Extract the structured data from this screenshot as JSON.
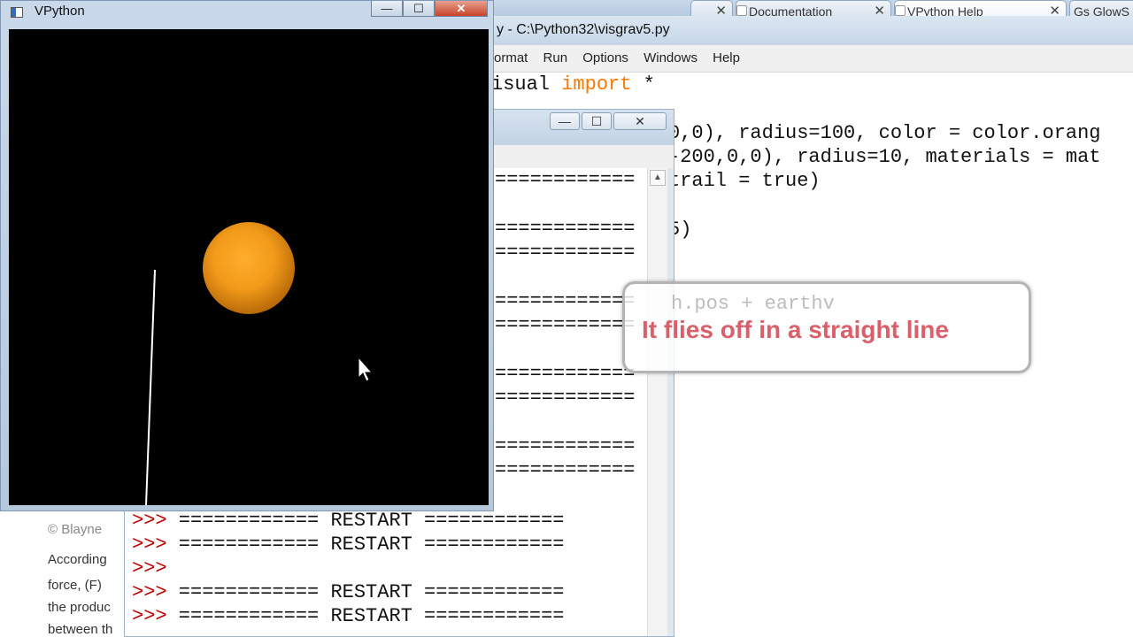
{
  "browser": {
    "tabs": [
      {
        "label": "",
        "close": "✕"
      },
      {
        "label": "Documentation",
        "close": "✕"
      },
      {
        "label": "VPython Help",
        "close": "✕"
      },
      {
        "label": "Gs GlowS",
        "close": ""
      }
    ]
  },
  "editor": {
    "title": "y - C:\\Python32\\visgrav5.py",
    "menu": [
      "ormat",
      "Run",
      "Options",
      "Windows",
      "Help"
    ],
    "code_lines": [
      {
        "pre": "isual ",
        "kw": "import",
        "post": " *"
      },
      {
        "pre": "",
        "kw": "",
        "post": ""
      },
      {
        "pre": "0,0), radius=100, color = color.orang",
        "kw": "",
        "post": ""
      },
      {
        "pre": "-200,0,0), radius=10, materials = mat",
        "kw": "",
        "post": ""
      },
      {
        "pre": "trail = true)",
        "kw": "",
        "post": ""
      },
      {
        "pre": "",
        "kw": "",
        "post": ""
      },
      {
        "pre": "5)",
        "kw": "",
        "post": ""
      }
    ]
  },
  "shell": {
    "controls": {
      "minimize": "—",
      "maximize": "☐",
      "close": "✕"
    },
    "partial_lines": [
      "============",
      "",
      "============",
      "============",
      "",
      "============",
      "============",
      "",
      "============",
      "============",
      "",
      "============",
      "============"
    ],
    "lines": [
      {
        "prompt": ">>>",
        "text": " ============ RESTART ============"
      },
      {
        "prompt": ">>>",
        "text": " ============ RESTART ============"
      },
      {
        "prompt": ">>>",
        "text": ""
      },
      {
        "prompt": ">>>",
        "text": " ============ RESTART ============"
      },
      {
        "prompt": ">>>",
        "text": " ============ RESTART ============"
      }
    ]
  },
  "website": {
    "lines": [
      "© Blayne",
      "According",
      "force, (F)",
      "the produc",
      "between th"
    ]
  },
  "vpython": {
    "title": "VPython",
    "controls": {
      "minimize": "—",
      "maximize": "☐",
      "close": "✕"
    }
  },
  "callout": {
    "code": "h.pos + earthv",
    "text": "It flies off in a straight line"
  },
  "colors": {
    "sun": "#f29a1a",
    "trail": "#ffffff",
    "keyword": "#ff7700",
    "prompt": "#c00000",
    "callout_text": "#d9606a"
  }
}
